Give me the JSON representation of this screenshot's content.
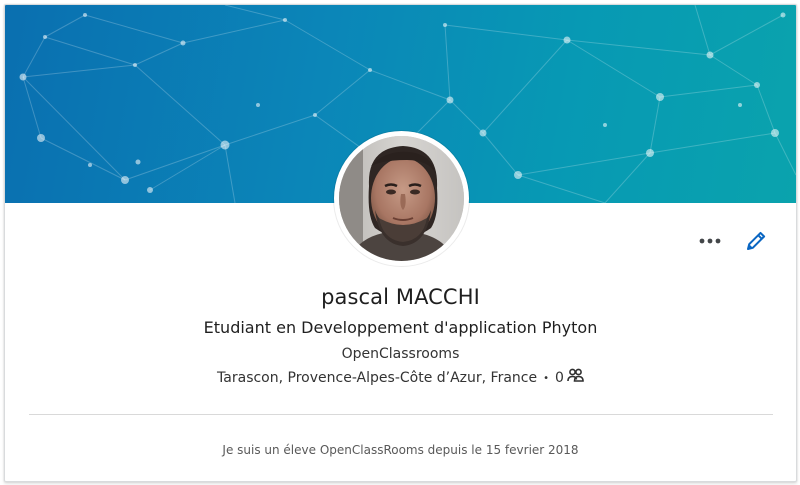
{
  "profile": {
    "name": "pascal MACCHI",
    "headline": "Etudiant en Developpement d'application Phyton",
    "company": "OpenClassrooms",
    "location": "Tarascon, Provence-Alpes-Côte d’Azur, France",
    "separator": "•",
    "connections": "0",
    "summary": "Je suis un éleve OpenClassRooms depuis le 15 fevrier 2018"
  },
  "icons": {
    "more": "more-horizontal-icon",
    "edit": "pencil-icon",
    "connections": "people-icon"
  },
  "colors": {
    "banner_start": "#0a6fb0",
    "banner_end": "#0aa3ad",
    "edit_icon": "#0a66c2",
    "more_icon": "#434649"
  }
}
